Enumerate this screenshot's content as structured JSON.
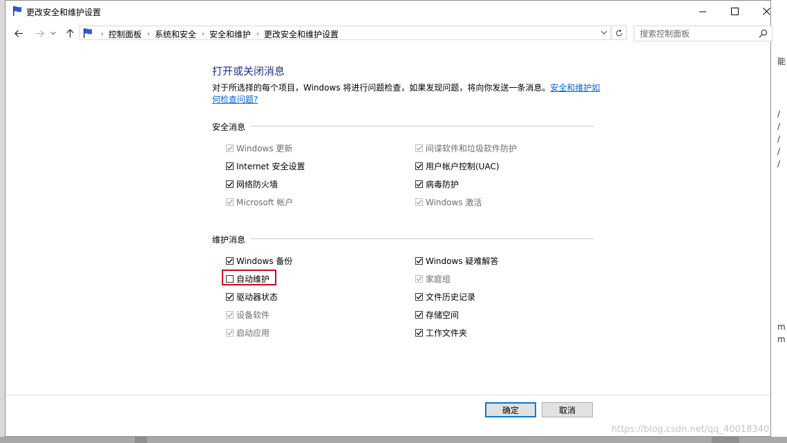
{
  "window": {
    "title": "更改安全和维护设置",
    "controls": [
      "minimize",
      "maximize",
      "close"
    ]
  },
  "address_bar": {
    "breadcrumbs": [
      "控制面板",
      "系统和安全",
      "安全和维护",
      "更改安全和维护设置"
    ],
    "search_placeholder": "搜索控制面板"
  },
  "main": {
    "heading": "打开或关闭消息",
    "description": "对于所选择的每个项目，Windows 将进行问题检查，如果发现问题，将向你发送一条消息。",
    "link": "安全和维护如何检查问题?",
    "link_line1": "安全和维护如",
    "link_line2": "何检查问题?"
  },
  "security": {
    "title": "安全消息",
    "items": [
      {
        "label": "Windows 更新",
        "checked": true,
        "enabled": false
      },
      {
        "label": "间谍软件和垃圾软件防护",
        "checked": true,
        "enabled": false
      },
      {
        "label": "Internet 安全设置",
        "checked": true,
        "enabled": true
      },
      {
        "label": "用户帐户控制(UAC)",
        "checked": true,
        "enabled": true
      },
      {
        "label": "网络防火墙",
        "checked": true,
        "enabled": true
      },
      {
        "label": "病毒防护",
        "checked": true,
        "enabled": true
      },
      {
        "label": "Microsoft 帐户",
        "checked": true,
        "enabled": false
      },
      {
        "label": "Windows 激活",
        "checked": true,
        "enabled": false
      }
    ]
  },
  "maintenance": {
    "title": "维护消息",
    "items": [
      {
        "label": "Windows 备份",
        "checked": true,
        "enabled": true
      },
      {
        "label": "Windows 疑难解答",
        "checked": true,
        "enabled": true
      },
      {
        "label": "自动维护",
        "checked": false,
        "enabled": true
      },
      {
        "label": "家庭组",
        "checked": true,
        "enabled": false
      },
      {
        "label": "驱动器状态",
        "checked": true,
        "enabled": true
      },
      {
        "label": "文件历史记录",
        "checked": true,
        "enabled": true
      },
      {
        "label": "设备软件",
        "checked": true,
        "enabled": false
      },
      {
        "label": "存储空间",
        "checked": true,
        "enabled": true
      },
      {
        "label": "启动应用",
        "checked": true,
        "enabled": false
      },
      {
        "label": "工作文件夹",
        "checked": true,
        "enabled": true
      }
    ]
  },
  "buttons": {
    "ok": "确定",
    "cancel": "取消"
  },
  "watermark": "https://blog.csdn.net/qq_40018340",
  "colors": {
    "heading": "#1e3287",
    "link": "#0066cc",
    "highlight": "#d0021b",
    "primary_border": "#0078d7"
  }
}
